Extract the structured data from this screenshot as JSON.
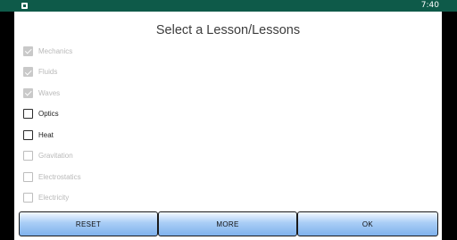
{
  "status_bar": {
    "time": "7:40",
    "app_icon": "app-notification-icon",
    "color": "#0e5a49"
  },
  "dialog": {
    "title": "Select a Lesson/Lessons",
    "lessons": [
      {
        "label": "Mechanics",
        "checked": true,
        "enabled": false
      },
      {
        "label": "Fluids",
        "checked": true,
        "enabled": false
      },
      {
        "label": "Waves",
        "checked": true,
        "enabled": false
      },
      {
        "label": "Optics",
        "checked": false,
        "enabled": true
      },
      {
        "label": "Heat",
        "checked": false,
        "enabled": true
      },
      {
        "label": "Gravitation",
        "checked": false,
        "enabled": false
      },
      {
        "label": "Electrostatics",
        "checked": false,
        "enabled": false
      },
      {
        "label": "Electricity",
        "checked": false,
        "enabled": false
      }
    ],
    "buttons": {
      "reset": "RESET",
      "more": "MORE",
      "ok": "OK"
    },
    "button_color": "#7fb1ec"
  }
}
